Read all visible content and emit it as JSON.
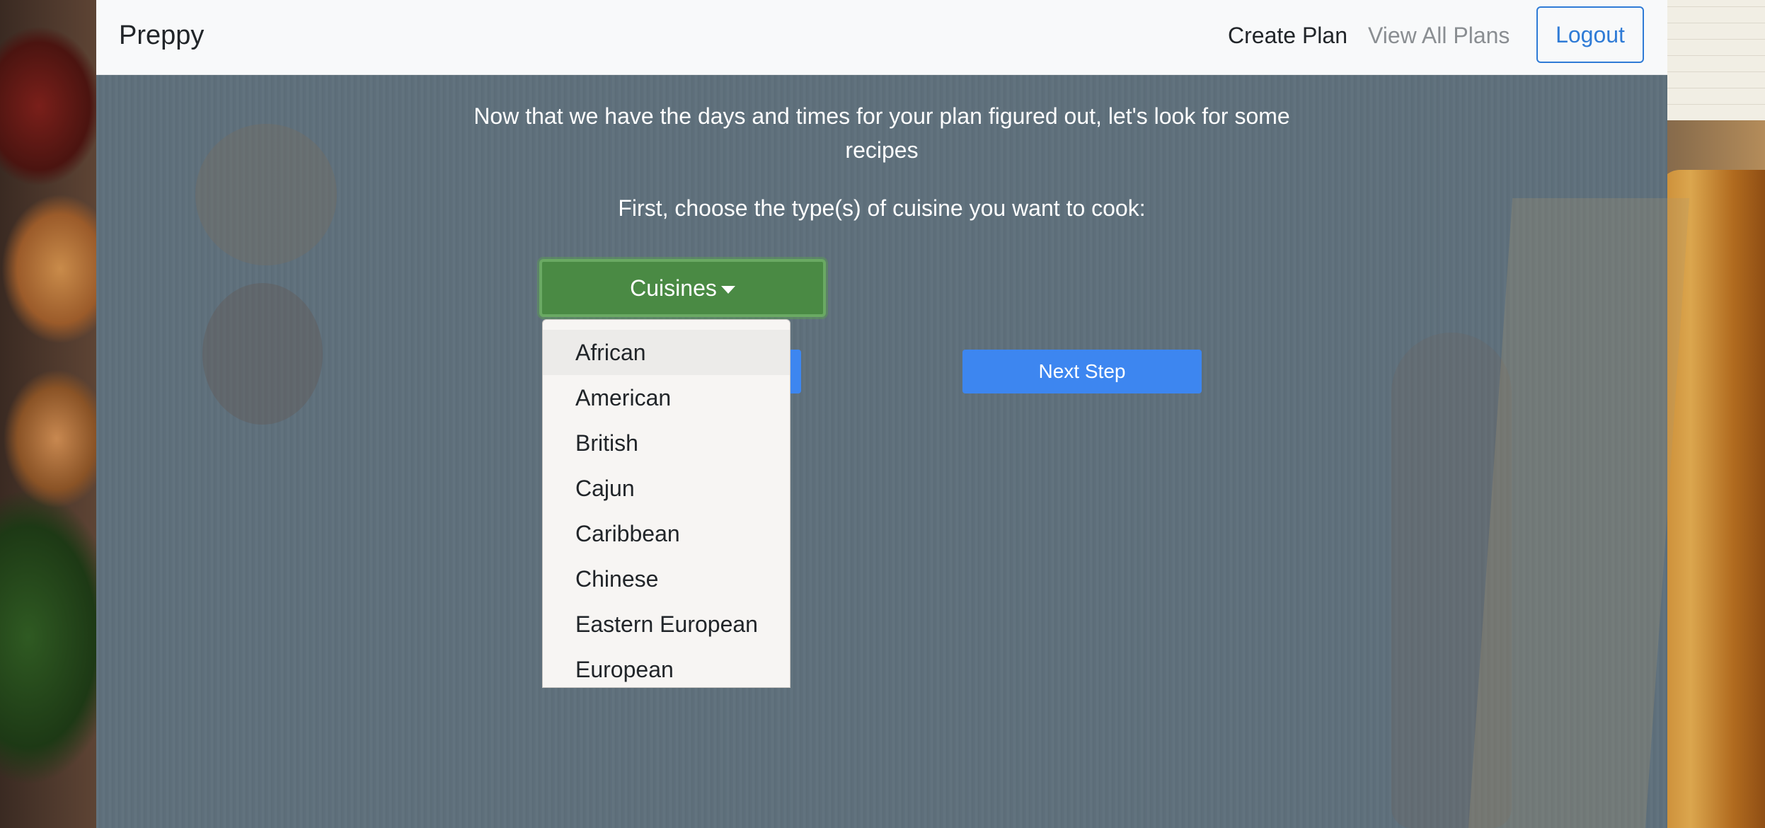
{
  "navbar": {
    "brand": "Preppy",
    "links": {
      "create_plan": "Create Plan",
      "view_all_plans": "View All Plans"
    },
    "logout_label": "Logout"
  },
  "main": {
    "intro_text": "Now that we have the days and times for your plan figured out, let's look for some recipes",
    "prompt_text": "First, choose the type(s) of cuisine you want to cook:",
    "cuisines_button_label": "Cuisines",
    "next_step_label": "Next Step"
  },
  "cuisines_dropdown": {
    "items": [
      "African",
      "American",
      "British",
      "Cajun",
      "Caribbean",
      "Chinese",
      "Eastern European",
      "European"
    ]
  },
  "colors": {
    "navbar_bg": "#f8f9fa",
    "panel_overlay": "#5f707c",
    "cuisines_button": "#4a8a44",
    "primary_button": "#3d86f0",
    "logout_outline": "#2f7bd6",
    "dropdown_bg": "#f7f5f3"
  },
  "icons": {
    "cuisines_caret": "caret-down-icon"
  }
}
